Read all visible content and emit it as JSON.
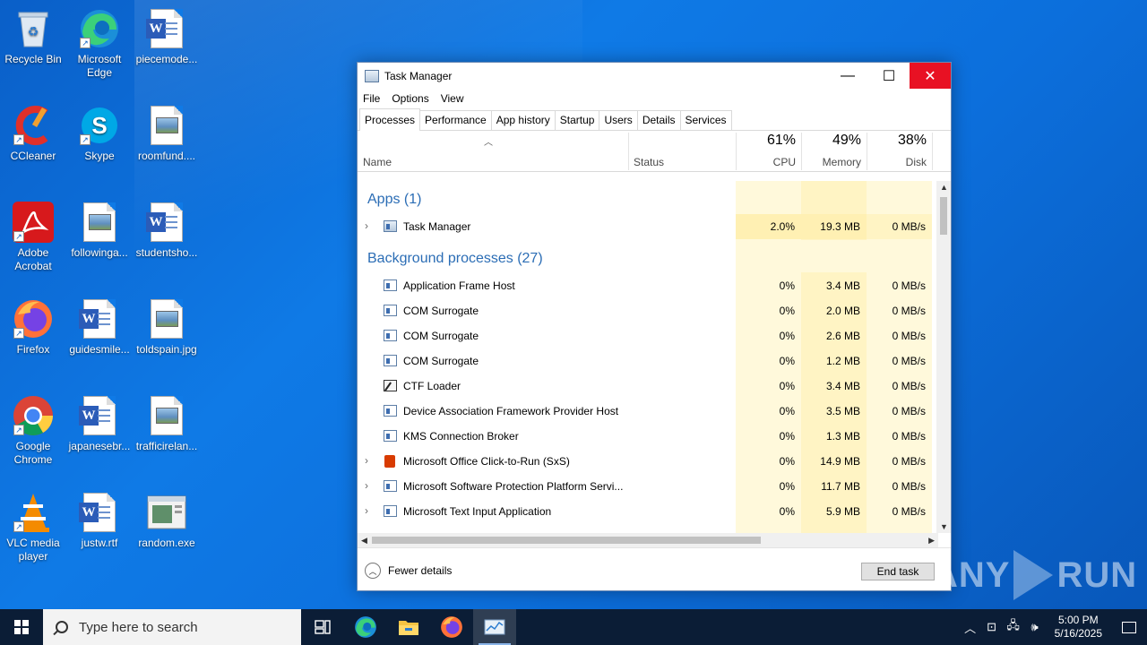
{
  "desktop": {
    "icons": [
      {
        "label": "Recycle Bin"
      },
      {
        "label": "Microsoft Edge"
      },
      {
        "label": "piecemode..."
      },
      {
        "label": "CCleaner"
      },
      {
        "label": "Skype"
      },
      {
        "label": "roomfund...."
      },
      {
        "label": "Adobe Acrobat"
      },
      {
        "label": "followinga..."
      },
      {
        "label": "studentsho..."
      },
      {
        "label": "Firefox"
      },
      {
        "label": "guidesmile..."
      },
      {
        "label": "toldspain.jpg"
      },
      {
        "label": "Google Chrome"
      },
      {
        "label": "japanesebr..."
      },
      {
        "label": "trafficirelan..."
      },
      {
        "label": "VLC media player"
      },
      {
        "label": "justw.rtf"
      },
      {
        "label": "random.exe"
      }
    ]
  },
  "window": {
    "title": "Task Manager",
    "minimize_glyph": "—",
    "maximize_glyph": "☐",
    "close_glyph": "✕",
    "menu": [
      "File",
      "Options",
      "View"
    ],
    "tabs": [
      "Processes",
      "Performance",
      "App history",
      "Startup",
      "Users",
      "Details",
      "Services"
    ],
    "active_tab": "Processes"
  },
  "columns": {
    "name": "Name",
    "status": "Status",
    "cpu": {
      "label": "CPU",
      "pct": "61%"
    },
    "memory": {
      "label": "Memory",
      "pct": "49%"
    },
    "disk": {
      "label": "Disk",
      "pct": "38%"
    }
  },
  "groups": {
    "apps": "Apps (1)",
    "background": "Background processes (27)"
  },
  "processes": [
    {
      "name": "Task Manager",
      "cpu": "2.0%",
      "memory": "19.3 MB",
      "disk": "0 MB/s"
    },
    {
      "name": "Application Frame Host",
      "cpu": "0%",
      "memory": "3.4 MB",
      "disk": "0 MB/s"
    },
    {
      "name": "COM Surrogate",
      "cpu": "0%",
      "memory": "2.0 MB",
      "disk": "0 MB/s"
    },
    {
      "name": "COM Surrogate",
      "cpu": "0%",
      "memory": "2.6 MB",
      "disk": "0 MB/s"
    },
    {
      "name": "COM Surrogate",
      "cpu": "0%",
      "memory": "1.2 MB",
      "disk": "0 MB/s"
    },
    {
      "name": "CTF Loader",
      "cpu": "0%",
      "memory": "3.4 MB",
      "disk": "0 MB/s"
    },
    {
      "name": "Device Association Framework Provider Host",
      "cpu": "0%",
      "memory": "3.5 MB",
      "disk": "0 MB/s"
    },
    {
      "name": "KMS Connection Broker",
      "cpu": "0%",
      "memory": "1.3 MB",
      "disk": "0 MB/s"
    },
    {
      "name": "Microsoft Office Click-to-Run (SxS)",
      "cpu": "0%",
      "memory": "14.9 MB",
      "disk": "0 MB/s"
    },
    {
      "name": "Microsoft Software Protection Platform Servi...",
      "cpu": "0%",
      "memory": "11.7 MB",
      "disk": "0 MB/s"
    },
    {
      "name": "Microsoft Text Input Application",
      "cpu": "0%",
      "memory": "5.9 MB",
      "disk": "0 MB/s"
    }
  ],
  "footer": {
    "fewer_details": "Fewer details",
    "end_task": "End task"
  },
  "watermark": {
    "left": "ANY",
    "right": "RUN"
  },
  "taskbar": {
    "search_placeholder": "Type here to search",
    "time": "5:00 PM",
    "date": "5/16/2025"
  },
  "colors": {
    "accent": "#2b6db5",
    "heat_light": "#fff9db",
    "heat_medium": "#fff0b3",
    "close_red": "#e81123",
    "taskbar": "#0b1d36"
  }
}
